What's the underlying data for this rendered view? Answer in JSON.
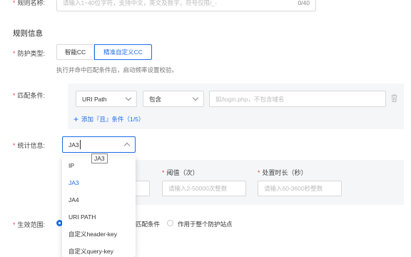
{
  "top": {
    "name_label": "规则名称:",
    "name_placeholder": "请输入1~40位字符，支持中文，英文及数字，符号仅限/_-",
    "name_counter": "0/40"
  },
  "section": {
    "title": "规则信息"
  },
  "protect_type": {
    "label": "防护类型:",
    "options": [
      "智能CC",
      "精准自定义CC"
    ],
    "hint": "执行并命中匹配条件后，启动频率设置校验。"
  },
  "match": {
    "label": "匹配条件:",
    "field_value": "URI Path",
    "operator_value": "包含",
    "value_placeholder": "如/login.php，不包含域名",
    "add_link": "添加『且』条件（1/5）"
  },
  "stats": {
    "label": "统计信息:",
    "selected": "JA3",
    "tooltip": "JA3",
    "options": [
      "IP",
      "JA3",
      "JA4",
      "URI PATH",
      "自定义header-key",
      "自定义query-key"
    ],
    "active_index": 1
  },
  "freq": {
    "threshold_label": "阈值（次）",
    "threshold_placeholder": "请输入2-50000次整数",
    "duration_label": "处置时长（秒）",
    "duration_placeholder": "请输入60-3600秒整数"
  },
  "scope": {
    "label": "生效范围:",
    "option1_tail": "匹配条件",
    "option2": "作用于整个防护站点"
  },
  "colors": {
    "accent": "#1c6ee8",
    "required": "#e04646"
  }
}
